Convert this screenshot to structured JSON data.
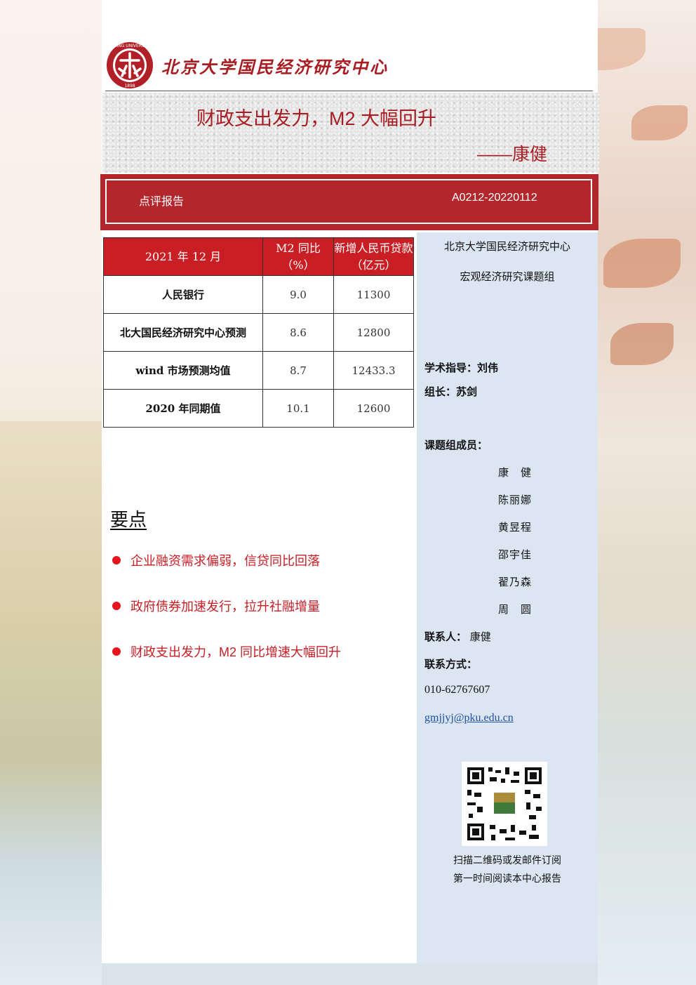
{
  "header": {
    "org_name": "北京大学国民经济研究中心",
    "logo_text": "PEKING UNIVERSITY",
    "logo_year": "1898"
  },
  "report": {
    "title": "财政支出发力，M2 大幅回升",
    "author": "——康健",
    "type": "点评报告",
    "code": "A0212-20220112"
  },
  "table": {
    "headers": [
      "2021 年 12 月",
      "M2 同比（%）",
      "新增人民币贷款（亿元）"
    ],
    "rows": [
      {
        "label": "人民银行",
        "m2": "9.0",
        "loans": "11300"
      },
      {
        "label": "北大国民经济研究中心预测",
        "m2": "8.6",
        "loans": "12800"
      },
      {
        "label": "wind 市场预测均值",
        "m2": "8.7",
        "loans": "12433.3"
      },
      {
        "label": "2020 年同期值",
        "m2": "10.1",
        "loans": "12600"
      }
    ]
  },
  "key_points": {
    "title": "要点",
    "items": [
      "企业融资需求偏弱，信贷同比回落",
      "政府债券加速发行，拉升社融增量",
      "财政支出发力，M2 同比增速大幅回升"
    ]
  },
  "sidebar": {
    "org": "北京大学国民经济研究中心",
    "group": "宏观经济研究课题组",
    "advisor": "学术指导：刘伟",
    "leader": "组长：苏剑",
    "members_label": "课题组成员：",
    "members": [
      "康　健",
      "陈丽娜",
      "黄昱程",
      "邵宇佳",
      "翟乃森",
      "周　圆"
    ],
    "contact_label": "联系人：",
    "contact_name": "康健",
    "contact_method_label": "联系方式：",
    "phone": "010-62767607",
    "email": "gmjjyj@pku.edu.cn",
    "qr_caption_1": "扫描二维码或发邮件订阅",
    "qr_caption_2": "第一时间阅读本中心报告"
  },
  "colors": {
    "brand_red": "#a81c22",
    "table_header": "#c81e24",
    "sidebar_bg": "#dce6f2"
  }
}
